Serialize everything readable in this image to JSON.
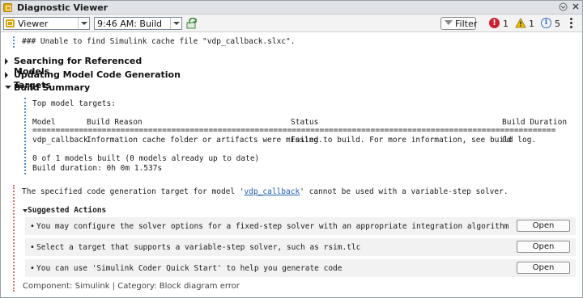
{
  "window": {
    "title": "Diagnostic Viewer"
  },
  "toolbar": {
    "viewer_label": "Viewer",
    "build_label": "9:46 AM: Build",
    "filter_label": "Filter",
    "error_count": "1",
    "warning_count": "1",
    "info_count": "5"
  },
  "messages": {
    "cache_warning": "### Unable to find Simulink cache file \"vdp_callback.slxc\".",
    "sections": [
      {
        "label": "Searching for Referenced Models",
        "expanded": false
      },
      {
        "label": "Updating Model Code Generation Targets",
        "expanded": false
      },
      {
        "label": "Build Summary",
        "expanded": true
      }
    ],
    "summary": {
      "top_targets": "Top model targets:",
      "header_model": "Model",
      "header_reason": "Build Reason",
      "header_status": "Status",
      "header_duration": "Build Duration",
      "separator": "================================================================================================================================",
      "row_model": "vdp_callback",
      "row_reason": "Information cache folder or artifacts were missing.",
      "row_status": "Failed to build. For more information, see build log.",
      "row_duration": "0d",
      "models_built": "0 of 1 models built (0 models already up to date)",
      "build_duration": "Build duration: 0h 0m 1.537s"
    },
    "error": {
      "prefix": "The specified code generation target for model '",
      "link": "vdp_callback",
      "suffix": "' cannot be used with a variable-step solver.",
      "suggested_title": "Suggested Actions",
      "actions": [
        {
          "text": "You may configure the solver options for a fixed-step solver with an appropriate integration algorithm",
          "button": "Open"
        },
        {
          "text": "Select a target that supports a variable-step solver, such as rsim.tlc",
          "button": "Open"
        },
        {
          "text": "You can use 'Simulink Coder Quick Start' to help you generate code",
          "button": "Open"
        }
      ],
      "footer": "Component: Simulink | Category: Block diagram error"
    }
  },
  "colors": {
    "error_red": "#d0202e",
    "warning_yellow": "#f2c200",
    "info_blue": "#2a71c4",
    "link_blue": "#1a5fb4",
    "brand_orange": "#e2a400"
  }
}
